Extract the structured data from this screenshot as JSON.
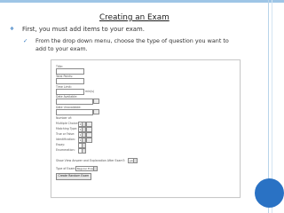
{
  "slide": {
    "title": "Creating an Exam",
    "bullet1": "First, you must add items to your exam.",
    "bullet2_line1": "From the drop down menu, choose the type of question you want to",
    "bullet2_line2": "add to your exam.",
    "bullet1_marker": "❖",
    "bullet2_marker": "✓"
  },
  "form": {
    "title_label": "Title:",
    "total_points_label": "Total Points:",
    "time_limit_label": "Time Limit:",
    "time_unit": "min(s)",
    "date_available_label": "Date Available:",
    "date_unavailable_label": "Date Unavailable:",
    "number_of_label": "Number of:",
    "question_types": [
      {
        "label": "Multiple Choice:",
        "value": "1"
      },
      {
        "label": "Matching Type:",
        "value": "1"
      },
      {
        "label": "True or False:",
        "value": "1"
      },
      {
        "label": "Identification:",
        "value": "1"
      },
      {
        "label": "Essay:",
        "value": ""
      },
      {
        "label": "Enumeration:",
        "value": ""
      }
    ],
    "show_answer_label": "Show View Answer and Explanation After Exam?:",
    "show_answer_value": "yes",
    "type_of_exam_label": "Type of Exam:",
    "type_of_exam_value": "Regular Exam",
    "create_button": "Create Random Exam"
  },
  "colors": {
    "accent": "#3b7fc4",
    "top_rule": "#9ec5e6",
    "page_circle": "#2a72c4"
  }
}
